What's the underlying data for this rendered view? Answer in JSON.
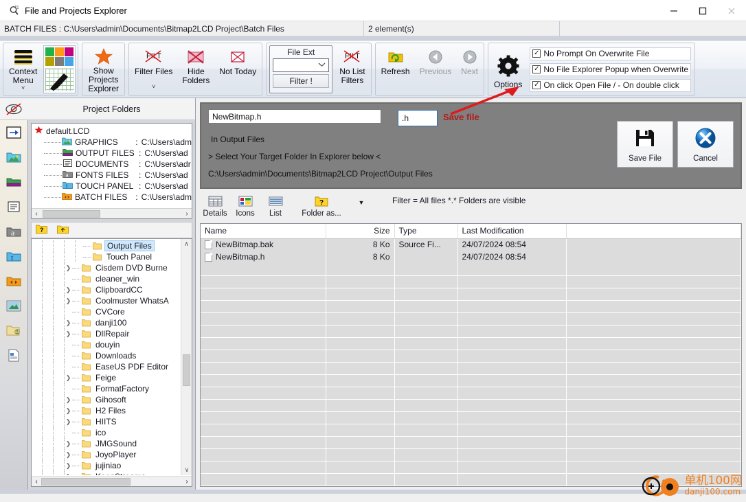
{
  "window": {
    "title": "File and Projects Explorer",
    "app_icon": "magnifier-icon",
    "minimize": "—",
    "maximize": "☐",
    "close": "✕"
  },
  "pathbar": {
    "project_path": "BATCH FILES : C:\\Users\\admin\\Documents\\Bitmap2LCD Project\\Batch Files",
    "element_count": "2 element(s)",
    "extra": ""
  },
  "ribbon": {
    "groups": [
      {
        "name": "context",
        "items": [
          {
            "label_line1": "Context",
            "label_line2": "Menu",
            "icon": "hamburger-menu-icon",
            "chevron": "˅"
          }
        ]
      },
      {
        "name": "projects",
        "items": [
          {
            "label_line1": "Show",
            "label_line2": "Projects",
            "label_line3": "Explorer",
            "icon": "star-icon"
          }
        ]
      },
      {
        "name": "filters",
        "items": [
          {
            "label_line1": "Filter Files",
            "icon": "filter-crossed-icon",
            "chevron": "˅"
          },
          {
            "label_line1": "Hide",
            "label_line2": "Folders",
            "icon": "hide-folders-icon"
          },
          {
            "label_line1": "Not Today",
            "icon": "not-today-icon"
          }
        ]
      },
      {
        "name": "fileext",
        "caption": "File Ext",
        "dropdown_value": "",
        "filter_button": "Filter !",
        "no_list_filters_line1": "No List",
        "no_list_filters_line2": "Filters"
      },
      {
        "name": "navigation",
        "items": [
          {
            "label_line1": "Refresh",
            "icon": "refresh-folder-icon",
            "dim": false
          },
          {
            "label_line1": "Previous",
            "icon": "arrow-left-circle-icon",
            "dim": true
          },
          {
            "label_line1": "Next",
            "icon": "arrow-right-circle-icon",
            "dim": true
          }
        ]
      },
      {
        "name": "options",
        "items": [
          {
            "label_line1": "Options",
            "icon": "gear-icon"
          }
        ],
        "checkboxes": [
          {
            "label": "No Prompt On Overwrite File",
            "checked": true
          },
          {
            "label": "No File Explorer Popup when Overwrite",
            "checked": true
          },
          {
            "label": "On click Open File / - On double click",
            "checked": true
          }
        ],
        "check_glyph": "✓"
      }
    ]
  },
  "iconstrip": {
    "eye_icon": "eye-hidden-icon",
    "items": [
      {
        "icon": "arrow-into-box-icon"
      },
      {
        "icon": "graphics-folder-icon"
      },
      {
        "icon": "output-folder-icon"
      },
      {
        "icon": "documents-folder-icon"
      },
      {
        "icon": "fonts-folder-icon"
      },
      {
        "icon": "touchpanel-folder-icon"
      },
      {
        "icon": "batch-folder-icon"
      },
      {
        "icon": "picture-icon"
      },
      {
        "icon": "user-folder-icon"
      },
      {
        "icon": "document-page-icon"
      }
    ]
  },
  "project_panel": {
    "header": "Project Folders",
    "root": {
      "label": "default.LCD",
      "icon": "red-star-icon"
    },
    "rows": [
      {
        "icon": "graphics-folder-icon",
        "name": "GRAPHICS",
        "sep": ":",
        "path": "C:\\Users\\adm"
      },
      {
        "icon": "output-folder-icon",
        "name": "OUTPUT FILES",
        "sep": ":",
        "path": "C:\\Users\\ad"
      },
      {
        "icon": "documents-folder-icon",
        "name": "DOCUMENTS",
        "sep": ":",
        "path": "C:\\Users\\adr"
      },
      {
        "icon": "fonts-folder-icon",
        "name": "FONTS FILES",
        "sep": ":",
        "path": "C:\\Users\\ad"
      },
      {
        "icon": "touchpanel-folder-icon",
        "name": "TOUCH PANEL",
        "sep": ":",
        "path": "C:\\Users\\ad"
      },
      {
        "icon": "batch-folder-icon",
        "name": "BATCH FILES",
        "sep": ":",
        "path": "C:\\Users\\adm"
      }
    ],
    "scroll_left": "‹",
    "scroll_right": "›"
  },
  "tree_toolbar": {
    "help_icon": "yellow-help-folder-icon",
    "up_icon": "folder-up-icon"
  },
  "folder_tree": {
    "items": [
      {
        "label": "Output Files",
        "indent": 4,
        "expandable": false,
        "selected": true
      },
      {
        "label": "Touch Panel",
        "indent": 4,
        "expandable": false,
        "selected": false
      },
      {
        "label": "Cisdem DVD Burne",
        "indent": 3,
        "expandable": true,
        "selected": false
      },
      {
        "label": "cleaner_win",
        "indent": 3,
        "expandable": false,
        "selected": false
      },
      {
        "label": "ClipboardCC",
        "indent": 3,
        "expandable": true,
        "selected": false
      },
      {
        "label": "Coolmuster WhatsA",
        "indent": 3,
        "expandable": true,
        "selected": false
      },
      {
        "label": "CVCore",
        "indent": 3,
        "expandable": false,
        "selected": false
      },
      {
        "label": "danji100",
        "indent": 3,
        "expandable": true,
        "selected": false
      },
      {
        "label": "DllRepair",
        "indent": 3,
        "expandable": true,
        "selected": false
      },
      {
        "label": "douyin",
        "indent": 3,
        "expandable": false,
        "selected": false
      },
      {
        "label": "Downloads",
        "indent": 3,
        "expandable": false,
        "selected": false
      },
      {
        "label": "EaseUS PDF Editor",
        "indent": 3,
        "expandable": false,
        "selected": false
      },
      {
        "label": "Feige",
        "indent": 3,
        "expandable": true,
        "selected": false
      },
      {
        "label": "FormatFactory",
        "indent": 3,
        "expandable": false,
        "selected": false
      },
      {
        "label": "Gihosoft",
        "indent": 3,
        "expandable": true,
        "selected": false
      },
      {
        "label": "H2 Files",
        "indent": 3,
        "expandable": true,
        "selected": false
      },
      {
        "label": "HIITS",
        "indent": 3,
        "expandable": true,
        "selected": false
      },
      {
        "label": "ico",
        "indent": 3,
        "expandable": false,
        "selected": false
      },
      {
        "label": "JMGSound",
        "indent": 3,
        "expandable": true,
        "selected": false
      },
      {
        "label": "JoyoPlayer",
        "indent": 3,
        "expandable": true,
        "selected": false
      },
      {
        "label": "jujiniao",
        "indent": 3,
        "expandable": true,
        "selected": false
      },
      {
        "label": "KeenStreams",
        "indent": 3,
        "expandable": true,
        "selected": false
      }
    ],
    "scroll_up": "∧",
    "scroll_down": "∨",
    "scroll_left": "‹",
    "scroll_right": "›"
  },
  "save_panel": {
    "filename": "NewBitmap.h",
    "extension": ".h",
    "line1": "In Output Files",
    "line2": "> Select Your Target Folder In Explorer below <",
    "line3": "C:\\Users\\admin\\Documents\\Bitmap2LCD Project\\Output Files",
    "save_button": {
      "label": "Save File",
      "icon": "floppy-save-icon"
    },
    "cancel_button": {
      "label": "Cancel",
      "icon": "blue-x-cancel-icon"
    }
  },
  "view_bar": {
    "items": [
      {
        "label": "Details",
        "icon": "details-view-icon"
      },
      {
        "label": "Icons",
        "icon": "icons-view-icon"
      },
      {
        "label": "List",
        "icon": "list-view-icon"
      },
      {
        "label": "Folder as...",
        "icon": "folder-as-icon"
      }
    ],
    "dropdown_glyph": "▼",
    "filter_info": "Filter = All files *.*  Folders are visible"
  },
  "file_list": {
    "columns": [
      "Name",
      "Size",
      "Type",
      "Last Modification",
      ""
    ],
    "rows": [
      {
        "name": "NewBitmap.bak",
        "size": "8 Ko",
        "type": "Source Fi...",
        "modified": "24/07/2024 08:54",
        "icon": "file-icon"
      },
      {
        "name": "NewBitmap.h",
        "size": "8 Ko",
        "type": "",
        "modified": "24/07/2024 08:54",
        "icon": "file-icon"
      }
    ],
    "empty_row_count": 18
  },
  "annotation": {
    "label": "Save file",
    "color": "#b01a1a",
    "arrow": "red-arrow-icon"
  },
  "watermark": {
    "cn": "单机100网",
    "en": "danji100.com",
    "color": "#f08020",
    "icon": "danji100-logo-icon"
  }
}
